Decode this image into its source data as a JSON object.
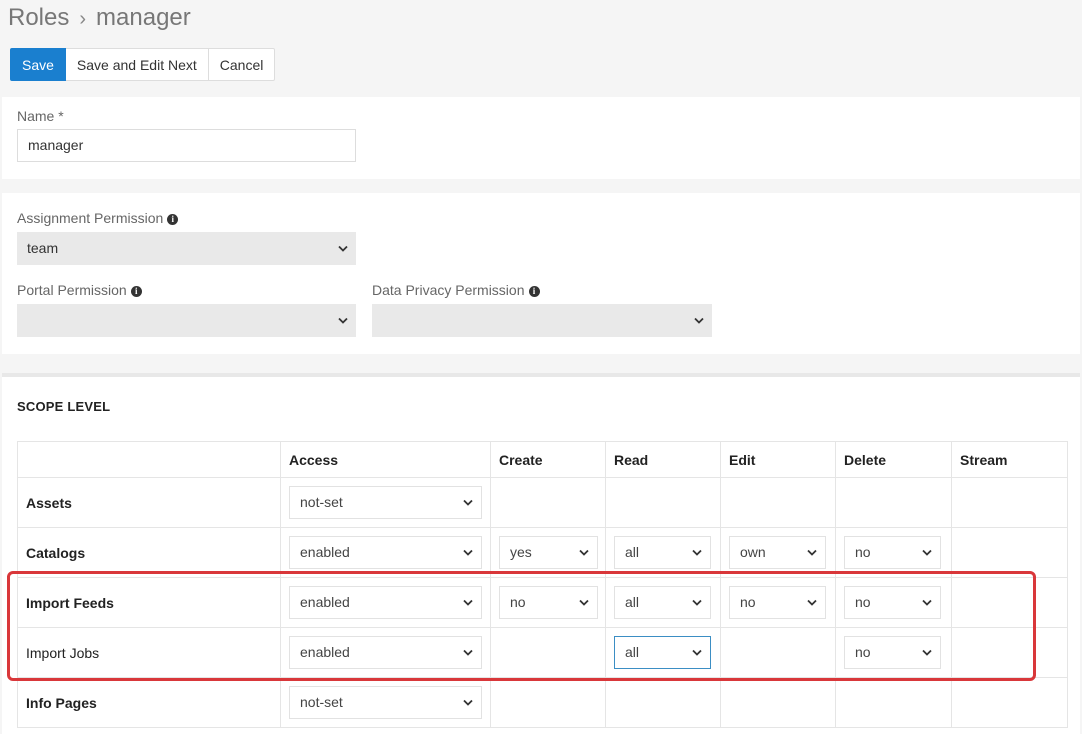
{
  "breadcrumb": {
    "parent": "Roles",
    "separator": "›",
    "current": "manager"
  },
  "toolbar": {
    "save_label": "Save",
    "save_edit_next_label": "Save and Edit Next",
    "cancel_label": "Cancel"
  },
  "form": {
    "name_label": "Name *",
    "name_value": "manager",
    "assignment_permission_label": "Assignment Permission",
    "assignment_permission_value": "team",
    "portal_permission_label": "Portal Permission",
    "portal_permission_value": "",
    "data_privacy_permission_label": "Data Privacy Permission",
    "data_privacy_permission_value": ""
  },
  "scope": {
    "title": "SCOPE LEVEL",
    "columns": [
      "",
      "Access",
      "Create",
      "Read",
      "Edit",
      "Delete",
      "Stream"
    ],
    "rows": [
      {
        "label": "Assets",
        "access": "not-set",
        "create": null,
        "read": null,
        "edit": null,
        "delete": null
      },
      {
        "label": "Catalogs",
        "access": "enabled",
        "create": "yes",
        "read": "all",
        "edit": "own",
        "delete": "no"
      },
      {
        "label": "Import Feeds",
        "access": "enabled",
        "create": "no",
        "read": "all",
        "edit": "no",
        "delete": "no"
      },
      {
        "label": "Import Jobs",
        "access": "enabled",
        "create": null,
        "read": "all",
        "edit": null,
        "delete": "no"
      },
      {
        "label": "Info Pages",
        "access": "not-set",
        "create": null,
        "read": null,
        "edit": null,
        "delete": null
      }
    ]
  },
  "colors": {
    "primary": "#1a7fcf",
    "highlight": "#d9373a",
    "focus_border": "#3b8ec4"
  },
  "icons": {
    "info": "info-icon",
    "dropdown": "chevron-down-icon"
  }
}
